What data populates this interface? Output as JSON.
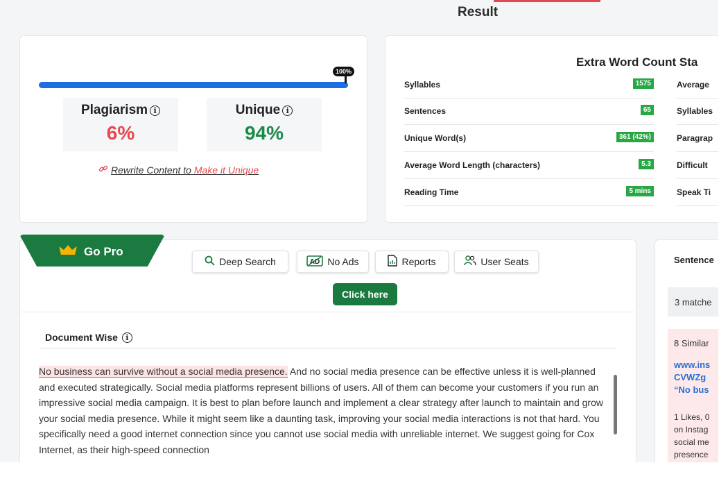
{
  "header": {
    "title": "Result"
  },
  "plagiarism": {
    "progress_label": "100%",
    "progress_fraction": 1.0,
    "plagiarism_label": "Plagiarism",
    "plagiarism_value": "6%",
    "unique_label": "Unique",
    "unique_value": "94%",
    "rewrite_text": "Rewrite Content to",
    "rewrite_link": "Make it Unique",
    "colors": {
      "plagiarism": "#e5484d",
      "unique": "#1a8a48",
      "bar": "#1b6fe0"
    }
  },
  "word_stats": {
    "title": "Extra Word Count Sta",
    "rows": [
      {
        "label": "Syllables",
        "value": "1575"
      },
      {
        "label": "Sentences",
        "value": "65"
      },
      {
        "label": "Unique Word(s)",
        "value": "361 (42%)"
      },
      {
        "label": "Average Word Length (characters)",
        "value": "5.3"
      },
      {
        "label": "Reading Time",
        "value": "5 mins"
      }
    ],
    "right_rows": [
      "Average",
      "Syllables",
      "Paragrap",
      "Difficult",
      "Speak Ti"
    ]
  },
  "pro": {
    "go_pro_label": "Go Pro",
    "features": [
      {
        "icon": "magnifier-icon",
        "label": "Deep Search"
      },
      {
        "icon": "ad-icon",
        "label": "No Ads"
      },
      {
        "icon": "report-icon",
        "label": "Reports"
      },
      {
        "icon": "users-icon",
        "label": "User Seats"
      }
    ],
    "cta_label": "Click here",
    "accent": "#1a7a3f"
  },
  "document": {
    "heading": "Document Wise",
    "highlighted": "No business can survive without a social media presence.",
    "text": " And no social media presence can be effective unless it is well-planned and executed strategically. Social media platforms represent billions of users. All of them can become your customers if you run an impressive social media campaign. It is best to plan before launch and implement a clear strategy after launch to maintain and grow your social media presence. While it might seem like a daunting task, improving your social media interactions is not that hard. You specifically need a good internet connection since you cannot use social media with unreliable internet. We suggest going for Cox Internet, as their high-speed connection"
  },
  "sentences": {
    "heading": "Sentence",
    "matches": "3 matche",
    "similar": "8 Similar",
    "link_lines": [
      "www.ins",
      "CVWZg",
      "“No bus"
    ],
    "body_lines": [
      "1 Likes, 0",
      "on Instag",
      "social me",
      "presence"
    ]
  }
}
